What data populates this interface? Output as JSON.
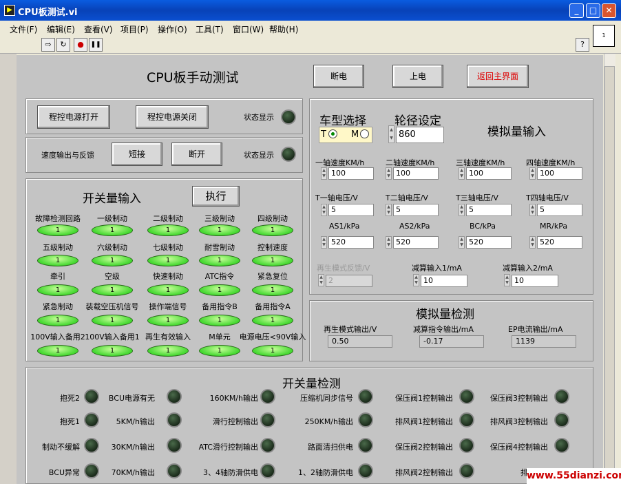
{
  "window": {
    "title": "CPU板测试.vi",
    "app_icon": "▶"
  },
  "menu": [
    "文件(F)",
    "编辑(E)",
    "查看(V)",
    "项目(P)",
    "操作(O)",
    "工具(T)",
    "窗口(W)",
    "帮助(H)"
  ],
  "toolbar": {
    "run": "⇨",
    "run_cont": "↻",
    "abort": "●",
    "pause": "❚❚",
    "help": "?",
    "vi_icon": "1"
  },
  "header": {
    "title": "CPU板手动测试",
    "btn_off": "断电",
    "btn_on": "上电",
    "btn_return": "返回主界面"
  },
  "power": {
    "open": "程控电源打开",
    "close": "程控电源关闭",
    "status": "状态显示"
  },
  "speed": {
    "label": "速度输出与反馈",
    "short": "短接",
    "open": "断开",
    "status": "状态显示"
  },
  "switch_in": {
    "title": "开关量输入",
    "exec": "执行",
    "items": [
      "故障检测回路",
      "一级制动",
      "二级制动",
      "三级制动",
      "四级制动",
      "五级制动",
      "六级制动",
      "七级制动",
      "耐雪制动",
      "控制速度",
      "牵引",
      "空级",
      "快速制动",
      "ATC指令",
      "紧急复位",
      "紧急制动",
      "装载空压机信号",
      "操作端信号",
      "备用指令B",
      "备用指令A",
      "100V输入备用2",
      "100V输入备用1",
      "再生有效输入",
      "M单元",
      "电源电压<90V输入"
    ],
    "led_text": "1"
  },
  "analog_in": {
    "car_label": "车型选择",
    "radio_t": "T",
    "radio_m": "M",
    "wheel_label": "轮径设定",
    "wheel_value": "860",
    "title": "模拟量输入",
    "speed_labels": [
      "一轴速度KM/h",
      "二轴速度KM/h",
      "三轴速度KM/h",
      "四轴速度KM/h"
    ],
    "speed_values": [
      "100",
      "100",
      "100",
      "100"
    ],
    "volt_labels": [
      "T一轴电压/V",
      "T二轴电压/V",
      "T三轴电压/V",
      "T四轴电压/V"
    ],
    "volt_values": [
      "5",
      "5",
      "5",
      "5"
    ],
    "press_labels": [
      "AS1/kPa",
      "AS2/kPa",
      "BC/kPa",
      "MR/kPa"
    ],
    "press_values": [
      "520",
      "520",
      "520",
      "520"
    ],
    "regen_label": "再生模式反馈/V",
    "regen_value": "2",
    "sub1_label": "减算输入1/mA",
    "sub1_value": "10",
    "sub2_label": "减算输入2/mA",
    "sub2_value": "10"
  },
  "analog_det": {
    "title": "模拟量检测",
    "labels": [
      "再生模式输出/V",
      "减算指令输出/mA",
      "EP电流输出/mA"
    ],
    "values": [
      "0.50",
      "-0.17",
      "1139"
    ]
  },
  "switch_det": {
    "title": "开关量检测",
    "items": [
      "抱死2",
      "BCU电源有无",
      "160KM/h输出",
      "压缩机同步信号",
      "保压阀1控制输出",
      "保压阀3控制输出",
      "抱死1",
      "5KM/h输出",
      "滑行控制输出",
      "250KM/h输出",
      "排风阀1控制输出",
      "排风阀3控制输出",
      "制动不缓解",
      "30KM/h输出",
      "ATC滑行控制输出",
      "路面清扫供电",
      "保压阀2控制输出",
      "保压阀4控制输出",
      "BCU异常",
      "70KM/h输出",
      "3、4轴防滑供电",
      "1、2轴防滑供电",
      "排风阀2控制输出",
      "排风阀4"
    ]
  },
  "watermark": "www.55dianzi.com"
}
